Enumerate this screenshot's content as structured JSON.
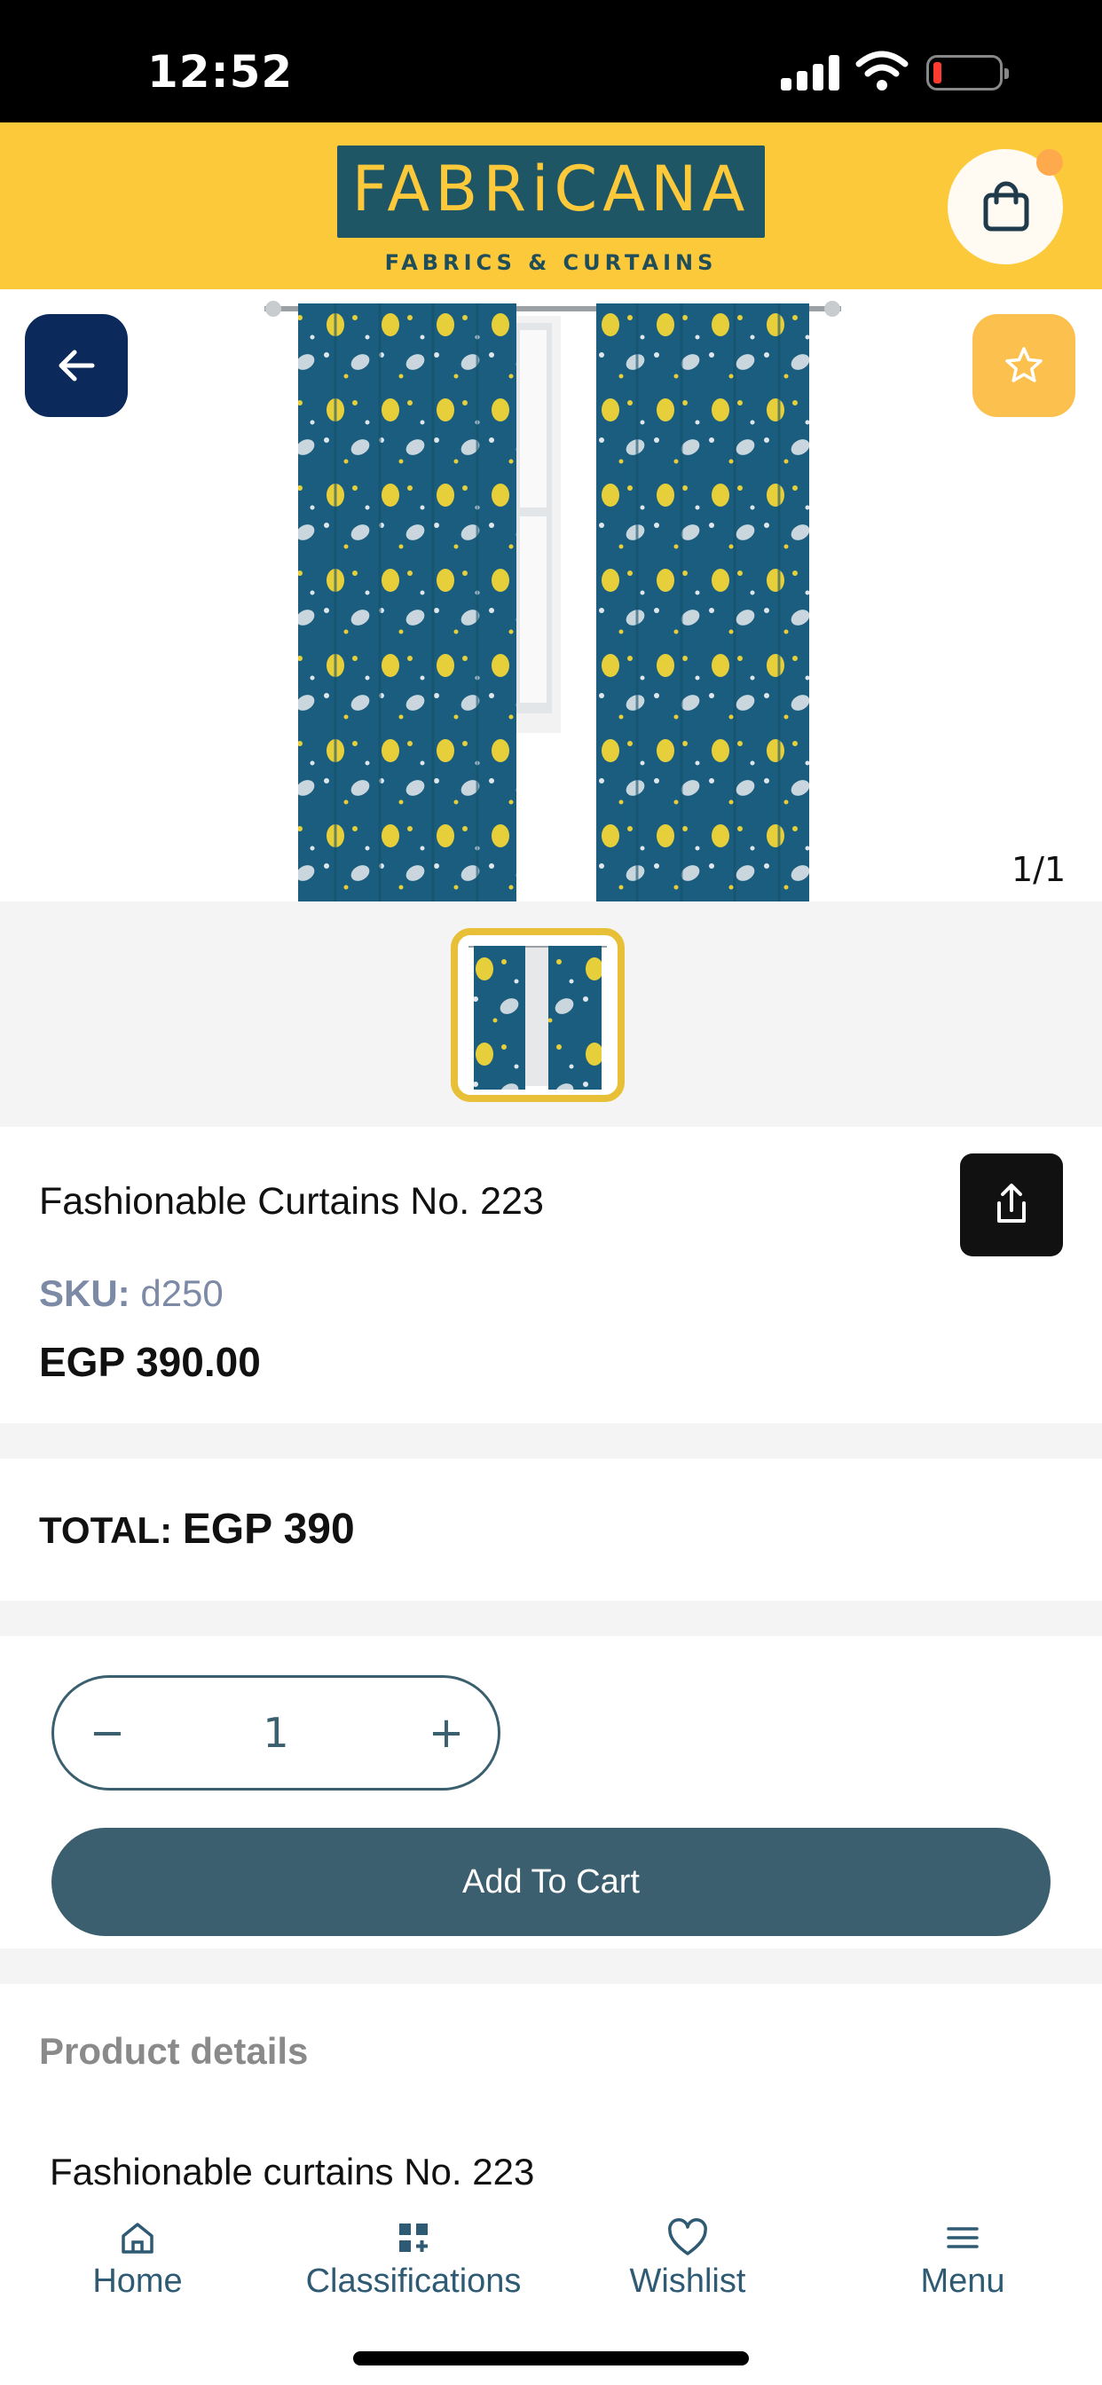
{
  "status_bar": {
    "time": "12:52"
  },
  "header": {
    "logo_text": "FABRiCANA",
    "logo_subtitle": "FABRICS & CURTAINS",
    "cart_icon": "shopping-bag-icon"
  },
  "gallery": {
    "pager": "1/1",
    "back_icon": "arrow-left-icon",
    "favorite_icon": "star-icon"
  },
  "product": {
    "title": "Fashionable Curtains No. 223",
    "sku_label": "SKU:",
    "sku_value": "d250",
    "price": "EGP 390.00",
    "share_icon": "share-icon"
  },
  "total": {
    "label": "TOTAL:",
    "amount": "EGP 390"
  },
  "cart": {
    "quantity": "1",
    "minus_symbol": "−",
    "plus_symbol": "+",
    "add_label": "Add To Cart"
  },
  "details": {
    "heading": "Product details",
    "text": "Fashionable curtains No. 223"
  },
  "nav": {
    "items": [
      {
        "label": "Home",
        "icon": "home-icon"
      },
      {
        "label": "Classifications",
        "icon": "grid-icon"
      },
      {
        "label": "Wishlist",
        "icon": "heart-icon"
      },
      {
        "label": "Menu",
        "icon": "menu-icon"
      }
    ]
  },
  "colors": {
    "header_yellow": "#fcc93b",
    "logo_teal": "#1f5666",
    "primary_button": "#3b5f6f",
    "back_button_navy": "#0b2a5b",
    "favorite_orange": "#fcc04f",
    "thumb_border": "#e8c038"
  }
}
